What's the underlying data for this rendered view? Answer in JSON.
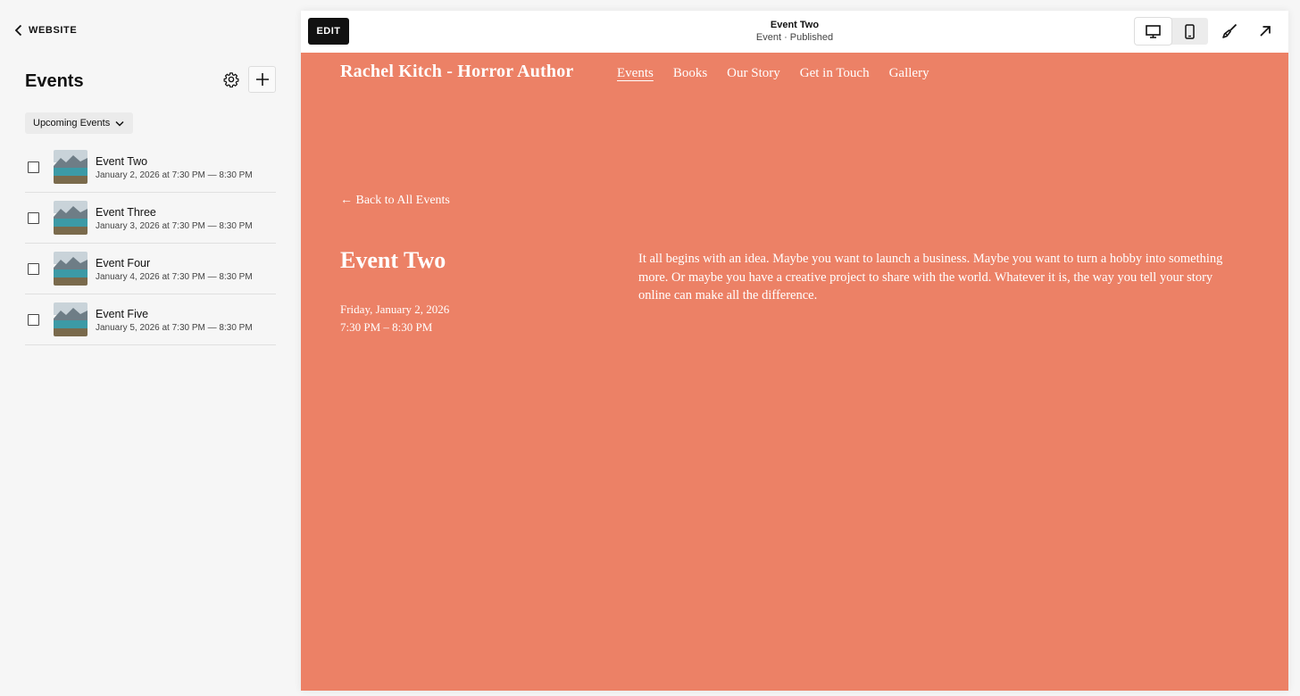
{
  "sidebar": {
    "back_label": "WEBSITE",
    "title": "Events",
    "filter_label": "Upcoming Events",
    "events": [
      {
        "title": "Event Two",
        "date": "January 2, 2026 at 7:30 PM — 8:30 PM"
      },
      {
        "title": "Event Three",
        "date": "January 3, 2026 at 7:30 PM — 8:30 PM"
      },
      {
        "title": "Event Four",
        "date": "January 4, 2026 at 7:30 PM — 8:30 PM"
      },
      {
        "title": "Event Five",
        "date": "January 5, 2026 at 7:30 PM — 8:30 PM"
      }
    ]
  },
  "toolbar": {
    "edit_label": "EDIT",
    "page_name": "Event Two",
    "page_status": "Event · Published"
  },
  "site": {
    "logo": "Rachel Kitch - Horror Author",
    "nav": [
      "Events",
      "Books",
      "Our Story",
      "Get in Touch",
      "Gallery"
    ],
    "back_link": "← Back to All Events",
    "event_title": "Event Two",
    "event_date": "Friday, January 2, 2026",
    "event_time": "7:30 PM – 8:30 PM",
    "event_body": "It all begins with an idea. Maybe you want to launch a business. Maybe you want to turn a hobby into something more. Or maybe you have a creative project to share with the world. Whatever it is, the way you tell your story online can make all the difference."
  },
  "colors": {
    "site_background": "#ec8166",
    "edit_button": "#111111"
  },
  "icons": {
    "back": "chevron-left-icon",
    "settings": "gear-icon",
    "add": "plus-icon",
    "filter": "chevron-down-icon",
    "desktop": "desktop-icon",
    "mobile": "mobile-icon",
    "design": "paintbrush-icon",
    "open": "arrow-up-right-icon"
  }
}
